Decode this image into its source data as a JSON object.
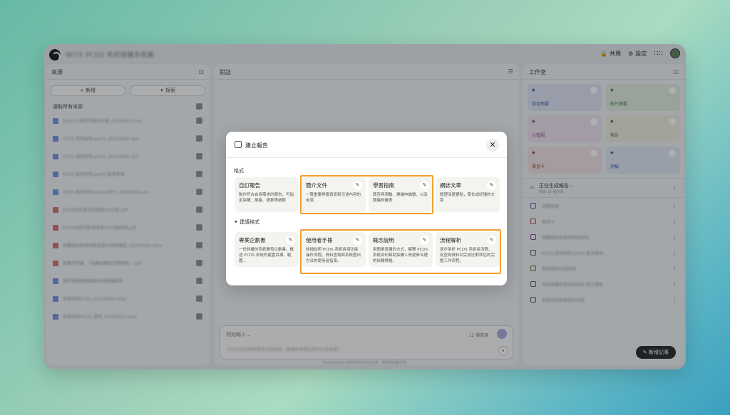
{
  "window": {
    "title": "WITS PCDS 系統採購系統案"
  },
  "topbar": {
    "share": "共用",
    "settings": "設定"
  },
  "sources": {
    "header": "來源",
    "add": "新增",
    "search": "探索",
    "select_all": "選取所有來源",
    "items": [
      {
        "name": "Docst上傳資料檔可計劃_20250620.asn",
        "color": "#6e8de0"
      },
      {
        "name": "PCDS 程序說明-part1_20250605.asn",
        "color": "#6e8de0"
      },
      {
        "name": "PCDS 程序說明-part2_20250605.asn",
        "color": "#6e8de0"
      },
      {
        "name": "PCDS 程序說明-part3 要求事項",
        "color": "#6e8de0"
      },
      {
        "name": "PCDS 程序說明-part4 WPS_20250605.asn",
        "color": "#6e8de0"
      },
      {
        "name": "PCDS系統需求說明書2025版.pdf",
        "color": "#d06a6a"
      },
      {
        "name": "PCDS系統功能規格書2025版說明.pdf",
        "color": "#d06a6a"
      },
      {
        "name": "採購案系統規格需求書內容建議版_20250605.docx",
        "color": "#d06a6a"
      },
      {
        "name": "採購案評審_「採購採購案完整規格」.pdf",
        "color": "#d06a6a"
      },
      {
        "name": "需求規格書建議版說明採購範圍",
        "color": "#6e8de0"
      },
      {
        "name": "系統規格PCDS_20250620.m4a",
        "color": "#6e8de0"
      },
      {
        "name": "系統規格PCDS_需求_20250620.m4a",
        "color": "#6e8de0"
      }
    ]
  },
  "chat": {
    "header": "對話",
    "placeholder": "開始輸入...",
    "count": "12 個來源",
    "suggestion": "PCDS系統規格需求內容說明，建議參考哪些資料作為依據？",
    "footnote": "NotebookLM 提供的資訊未必正確，請查證回覆內容。"
  },
  "studio": {
    "header": "工作室",
    "tiles": [
      {
        "label": "語音摘要",
        "bg": "#dde3f2",
        "fg": "#3a5da8"
      },
      {
        "label": "影片摘要",
        "bg": "#dfeadc",
        "fg": "#3a7a3a"
      },
      {
        "label": "心智圖",
        "bg": "#ece0ec",
        "fg": "#8a3a8a"
      },
      {
        "label": "報告",
        "bg": "#eeeedd",
        "fg": "#6a6a2a"
      },
      {
        "label": "學習卡",
        "bg": "#f0e0e0",
        "fg": "#b03a3a"
      },
      {
        "label": "測驗",
        "bg": "#dde6f2",
        "fg": "#3a5da8"
      }
    ],
    "generating": {
      "title": "正在生成報告...",
      "sub": "根據 12 個來源"
    },
    "notes": [
      {
        "title": "採購簡報",
        "color": "#3a5da8"
      },
      {
        "title": "學習卡",
        "color": "#b03a3a"
      },
      {
        "title": "採購案系統規格需求說明",
        "color": "#8a3a8a"
      },
      {
        "title": "PCDS 程序說明 part3 要求事項",
        "color": "#555"
      },
      {
        "title": "專案規格內容說明",
        "color": "#6a6a2a"
      },
      {
        "title": "系統採購案需求規格書 建立重點",
        "color": "#555"
      },
      {
        "title": "新進用系統開發與功能",
        "color": "#555"
      }
    ],
    "add_note": "新增記事"
  },
  "modal": {
    "title": "建立報告",
    "formats_label": "格式",
    "suggested_label": "建議格式",
    "formats": [
      {
        "title": "自訂報告",
        "desc": "製作符合自身需求的報告，可指定架構、風格、語氣等細節"
      },
      {
        "title": "簡介文件",
        "desc": "一覽重要與實資訊和引述內容的來源"
      },
      {
        "title": "學習指南",
        "desc": "簡答與測驗、建議申論題，以及關鍵詞彙表"
      },
      {
        "title": "網誌文章",
        "desc": "整理深度要點，簡化成好懂的文章"
      }
    ],
    "suggested": [
      {
        "title": "專案企劃書",
        "desc": "一份詳盡的系統開發企劃書，概述 PCDS 系統的建置目標、範圍..."
      },
      {
        "title": "使用者手冊",
        "desc": "詳細說明 PCDS 系統各項功能操作流程，資料查詢與系統匯出方法的使用者指南。"
      },
      {
        "title": "概念說明",
        "desc": "用簡單易懂的方式，解釋 PCDS 系統如何幫助採購人員提昇合理的採購價格。"
      },
      {
        "title": "流程解析",
        "desc": "逐步剖析 PCDS 系統各流程，從查詢資料到完成比對評估的完整工作流程。"
      }
    ]
  }
}
